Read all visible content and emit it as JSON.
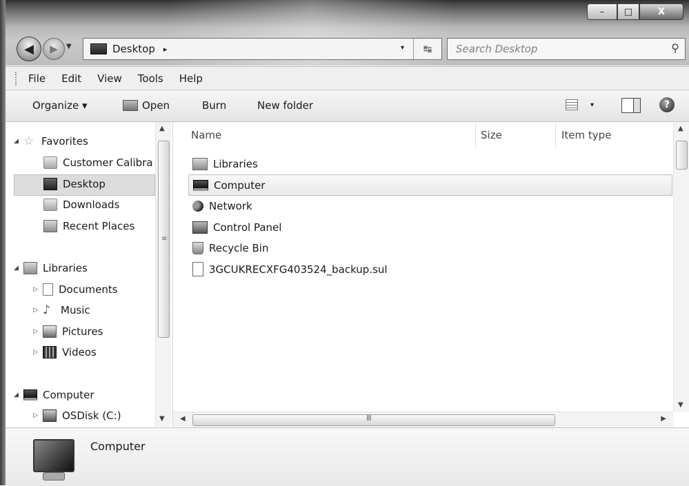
{
  "window": {
    "caption_buttons": {
      "minimize": "–",
      "maximize": "□",
      "close": "X"
    }
  },
  "address_bar": {
    "location": "Desktop",
    "crumb_arrow": "▸",
    "dropdown_glyph": "▾",
    "refresh_glyph": "↹"
  },
  "search": {
    "placeholder": "Search Desktop",
    "icon": "magnifier-icon"
  },
  "menu": [
    "File",
    "Edit",
    "View",
    "Tools",
    "Help"
  ],
  "toolbar": {
    "organize": "Organize ▾",
    "open": "Open",
    "burn": "Burn",
    "new_folder": "New folder",
    "views_dropdown": "▾",
    "help": "?"
  },
  "nav_pane": {
    "favorites": {
      "label": "Favorites",
      "items": [
        "Customer Calibra",
        "Desktop",
        "Downloads",
        "Recent Places"
      ]
    },
    "libraries": {
      "label": "Libraries",
      "items": [
        "Documents",
        "Music",
        "Pictures",
        "Videos"
      ]
    },
    "computer": {
      "label": "Computer",
      "items": [
        "OSDisk (C:)"
      ]
    },
    "selected": "Desktop"
  },
  "content": {
    "columns": [
      "Name",
      "Size",
      "Item type"
    ],
    "items": [
      {
        "name": "Libraries",
        "icon": "library-icon"
      },
      {
        "name": "Computer",
        "icon": "computer-icon",
        "selected": true
      },
      {
        "name": "Network",
        "icon": "network-icon"
      },
      {
        "name": "Control Panel",
        "icon": "control-panel-icon"
      },
      {
        "name": "Recycle Bin",
        "icon": "recycle-bin-icon"
      },
      {
        "name": "3GCUKRECXFG403524_backup.sul",
        "icon": "file-icon"
      }
    ],
    "hscroll_grip": "III"
  },
  "details": {
    "name": "Computer"
  }
}
